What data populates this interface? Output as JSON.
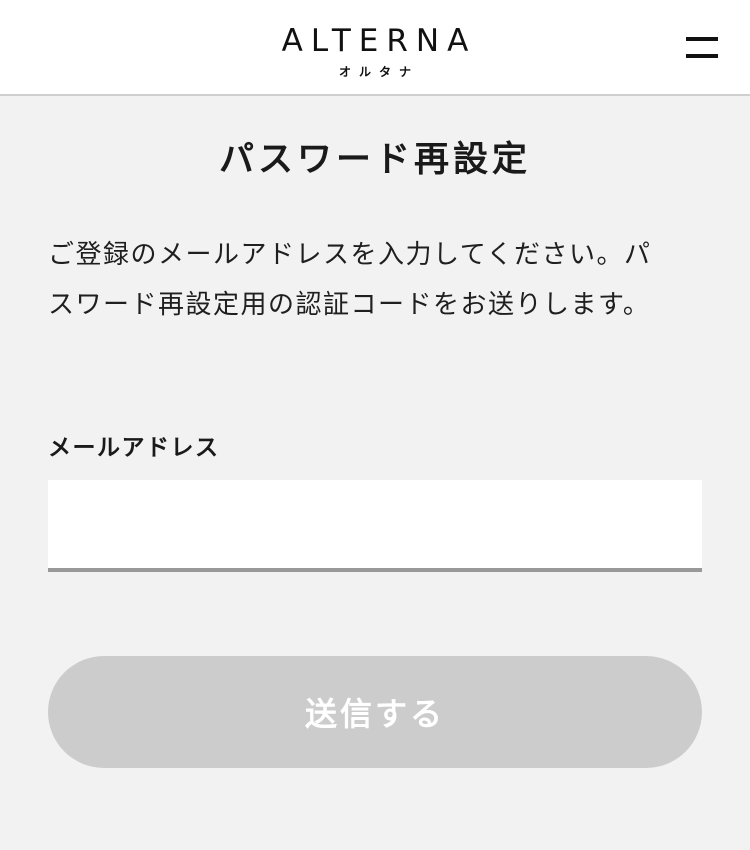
{
  "header": {
    "logo_main": "ALTERNA",
    "logo_sub": "オルタナ",
    "menu_icon": "hamburger-menu-icon"
  },
  "main": {
    "title": "パスワード再設定",
    "description": "ご登録のメールアドレスを入力してください。パスワード再設定用の認証コードをお送りします。",
    "email_label": "メールアドレス",
    "email_value": "",
    "email_placeholder": "",
    "submit_label": "送信する"
  },
  "colors": {
    "background": "#f2f2f2",
    "header_background": "#ffffff",
    "button_disabled": "#cccccc",
    "input_underline": "#999999"
  }
}
